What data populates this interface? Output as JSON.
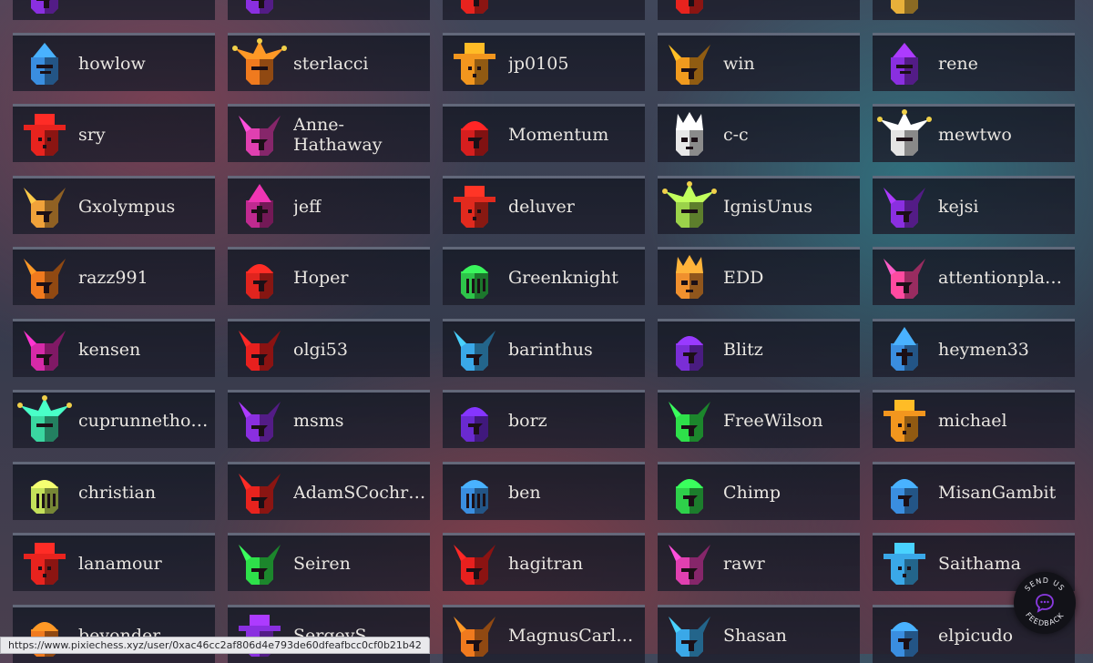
{
  "users": [
    {
      "name": "howlow",
      "avatar": "visor-helmet-icon",
      "color": "#3a8ee0"
    },
    {
      "name": "sterlacci",
      "avatar": "jester-hat-icon",
      "color": "#f07a1e"
    },
    {
      "name": "jp0105",
      "avatar": "brimmed-hat-icon",
      "color": "#f2961e"
    },
    {
      "name": "win",
      "avatar": "horned-helmet-icon",
      "color": "#f09a1e"
    },
    {
      "name": "rene",
      "avatar": "visor-helmet-icon",
      "color": "#8a2fe0"
    },
    {
      "name": "sry",
      "avatar": "brimmed-hat-icon",
      "color": "#e8231e"
    },
    {
      "name": "Anne-Hathaway",
      "avatar": "horned-helmet-icon",
      "color": "#e040b0"
    },
    {
      "name": "Momentum",
      "avatar": "round-helmet-icon",
      "color": "#d61e1e"
    },
    {
      "name": "c-c",
      "avatar": "crown-helmet-icon",
      "color": "#e8e8e8"
    },
    {
      "name": "mewtwo",
      "avatar": "jester-hat-icon",
      "color": "#e4e4e4"
    },
    {
      "name": "Gxolympus",
      "avatar": "horned-helmet-icon",
      "color": "#f0a23a"
    },
    {
      "name": "jeff",
      "avatar": "pointed-helmet-icon",
      "color": "#c02a90"
    },
    {
      "name": "deluver",
      "avatar": "brimmed-hat-icon",
      "color": "#e22a1e"
    },
    {
      "name": "IgnisUnus",
      "avatar": "jester-hat-icon",
      "color": "#9bd24a"
    },
    {
      "name": "kejsi",
      "avatar": "horned-helmet-icon",
      "color": "#8a2fe0"
    },
    {
      "name": "razz991",
      "avatar": "horned-helmet-icon",
      "color": "#f07a1e"
    },
    {
      "name": "Hoper",
      "avatar": "round-helmet-icon",
      "color": "#e0241e"
    },
    {
      "name": "Greenknight",
      "avatar": "barred-helmet-icon",
      "color": "#2ec44a"
    },
    {
      "name": "EDD",
      "avatar": "crown-helmet-icon",
      "color": "#f0902e"
    },
    {
      "name": "attentionplayer",
      "avatar": "horned-helmet-icon",
      "color": "#ff4aa0"
    },
    {
      "name": "kensen",
      "avatar": "horned-helmet-icon",
      "color": "#d62aa8"
    },
    {
      "name": "olgi53",
      "avatar": "horned-helmet-icon",
      "color": "#e8201e"
    },
    {
      "name": "barinthus",
      "avatar": "horned-helmet-icon",
      "color": "#3aa8e8"
    },
    {
      "name": "Blitz",
      "avatar": "round-helmet-icon",
      "color": "#7a2ed6"
    },
    {
      "name": "heymen33",
      "avatar": "pointed-helmet-icon",
      "color": "#3a8ee0"
    },
    {
      "name": "cuprunnethover",
      "avatar": "jester-hat-icon",
      "color": "#3ad6a0"
    },
    {
      "name": "msms",
      "avatar": "horned-helmet-icon",
      "color": "#8a2fe0"
    },
    {
      "name": "borz",
      "avatar": "round-helmet-icon",
      "color": "#6a2ad0"
    },
    {
      "name": "FreeWilson",
      "avatar": "horned-helmet-icon",
      "color": "#2ee04a"
    },
    {
      "name": "michael",
      "avatar": "brimmed-hat-icon",
      "color": "#f2961e"
    },
    {
      "name": "christian",
      "avatar": "barred-helmet-icon",
      "color": "#c4e05a"
    },
    {
      "name": "AdamSCochran",
      "avatar": "horned-helmet-icon",
      "color": "#e8231e"
    },
    {
      "name": "ben",
      "avatar": "barred-helmet-icon",
      "color": "#3a8ee0"
    },
    {
      "name": "Chimp",
      "avatar": "round-helmet-icon",
      "color": "#2ed04a"
    },
    {
      "name": "MisanGambit",
      "avatar": "round-helmet-icon",
      "color": "#3a8ee0"
    },
    {
      "name": "lanamour",
      "avatar": "brimmed-hat-icon",
      "color": "#e8231e"
    },
    {
      "name": "Seiren",
      "avatar": "horned-helmet-icon",
      "color": "#2ee04a"
    },
    {
      "name": "hagitran",
      "avatar": "horned-helmet-icon",
      "color": "#e8201e"
    },
    {
      "name": "rawr",
      "avatar": "horned-helmet-icon",
      "color": "#e040b0"
    },
    {
      "name": "Saithama",
      "avatar": "brimmed-hat-icon",
      "color": "#3aa8e8"
    },
    {
      "name": "beyonder",
      "avatar": "round-helmet-icon",
      "color": "#f07a1e"
    },
    {
      "name": "SergeyS",
      "avatar": "brimmed-hat-icon",
      "color": "#8a2fe0"
    },
    {
      "name": "MagnusCarls...",
      "avatar": "horned-helmet-icon",
      "color": "#f07a1e"
    },
    {
      "name": "Shasan",
      "avatar": "horned-helmet-icon",
      "color": "#3aa8e8"
    },
    {
      "name": "elpicudo",
      "avatar": "round-helmet-icon",
      "color": "#3a8ee0"
    }
  ],
  "top_partial_avatars": [
    {
      "avatar": "horned-helmet-icon",
      "color": "#8a2fe0"
    },
    {
      "avatar": "horned-helmet-icon",
      "color": "#8a2fe0"
    },
    {
      "avatar": "round-helmet-icon",
      "color": "#e8231e"
    },
    {
      "avatar": "round-helmet-icon",
      "color": "#e8231e"
    },
    {
      "avatar": "jester-hat-icon",
      "color": "#e8b03a"
    }
  ],
  "status_bar": {
    "url": "https://www.pixiechess.xyz/user/0xac46cc2af806d4e793de60dfeafbcc0cf0b21b42"
  },
  "feedback": {
    "label": "SEND US FEEDBACK",
    "top_text": "SEND US",
    "bottom_text": "FEEDBACK",
    "icon": "chat-bubble-icon",
    "accent": "#8a3ae0"
  }
}
